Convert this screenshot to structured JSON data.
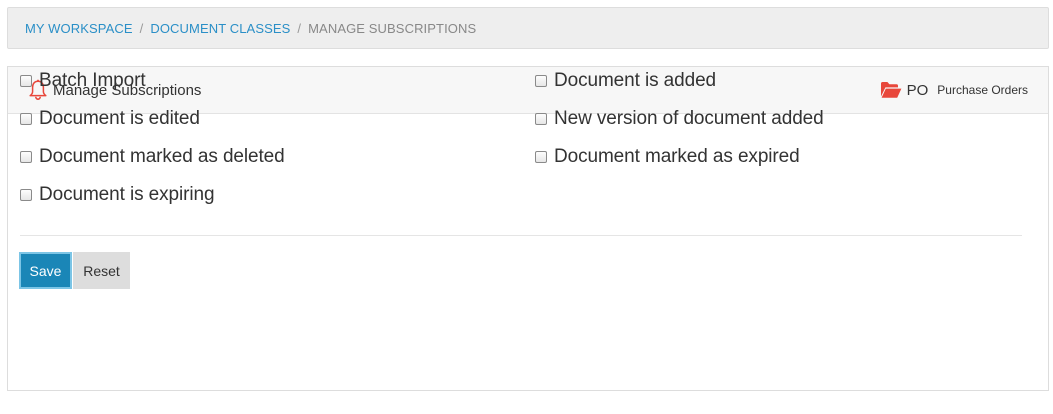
{
  "breadcrumb": {
    "items": [
      {
        "label": "MY WORKSPACE"
      },
      {
        "label": "DOCUMENT CLASSES"
      }
    ],
    "separator": "/",
    "current": "MANAGE SUBSCRIPTIONS"
  },
  "panel": {
    "title": "Manage Subscriptions",
    "title_icon": "bell-icon",
    "class_icon": "folder-open-icon",
    "class_code": "PO",
    "class_name": "Purchase Orders"
  },
  "subscriptions": [
    {
      "label": "Batch Import",
      "checked": false
    },
    {
      "label": "Document is added",
      "checked": false
    },
    {
      "label": "Document is edited",
      "checked": false
    },
    {
      "label": "New version of document added",
      "checked": false
    },
    {
      "label": "Document marked as deleted",
      "checked": false
    },
    {
      "label": "Document marked as expired",
      "checked": false
    },
    {
      "label": "Document is expiring",
      "checked": false
    }
  ],
  "actions": {
    "save_label": "Save",
    "reset_label": "Reset"
  },
  "colors": {
    "link": "#2a8fc7",
    "primary_button": "#1a86b7",
    "bell_icon": "#e8473b",
    "folder_icon": "#e8473b"
  }
}
